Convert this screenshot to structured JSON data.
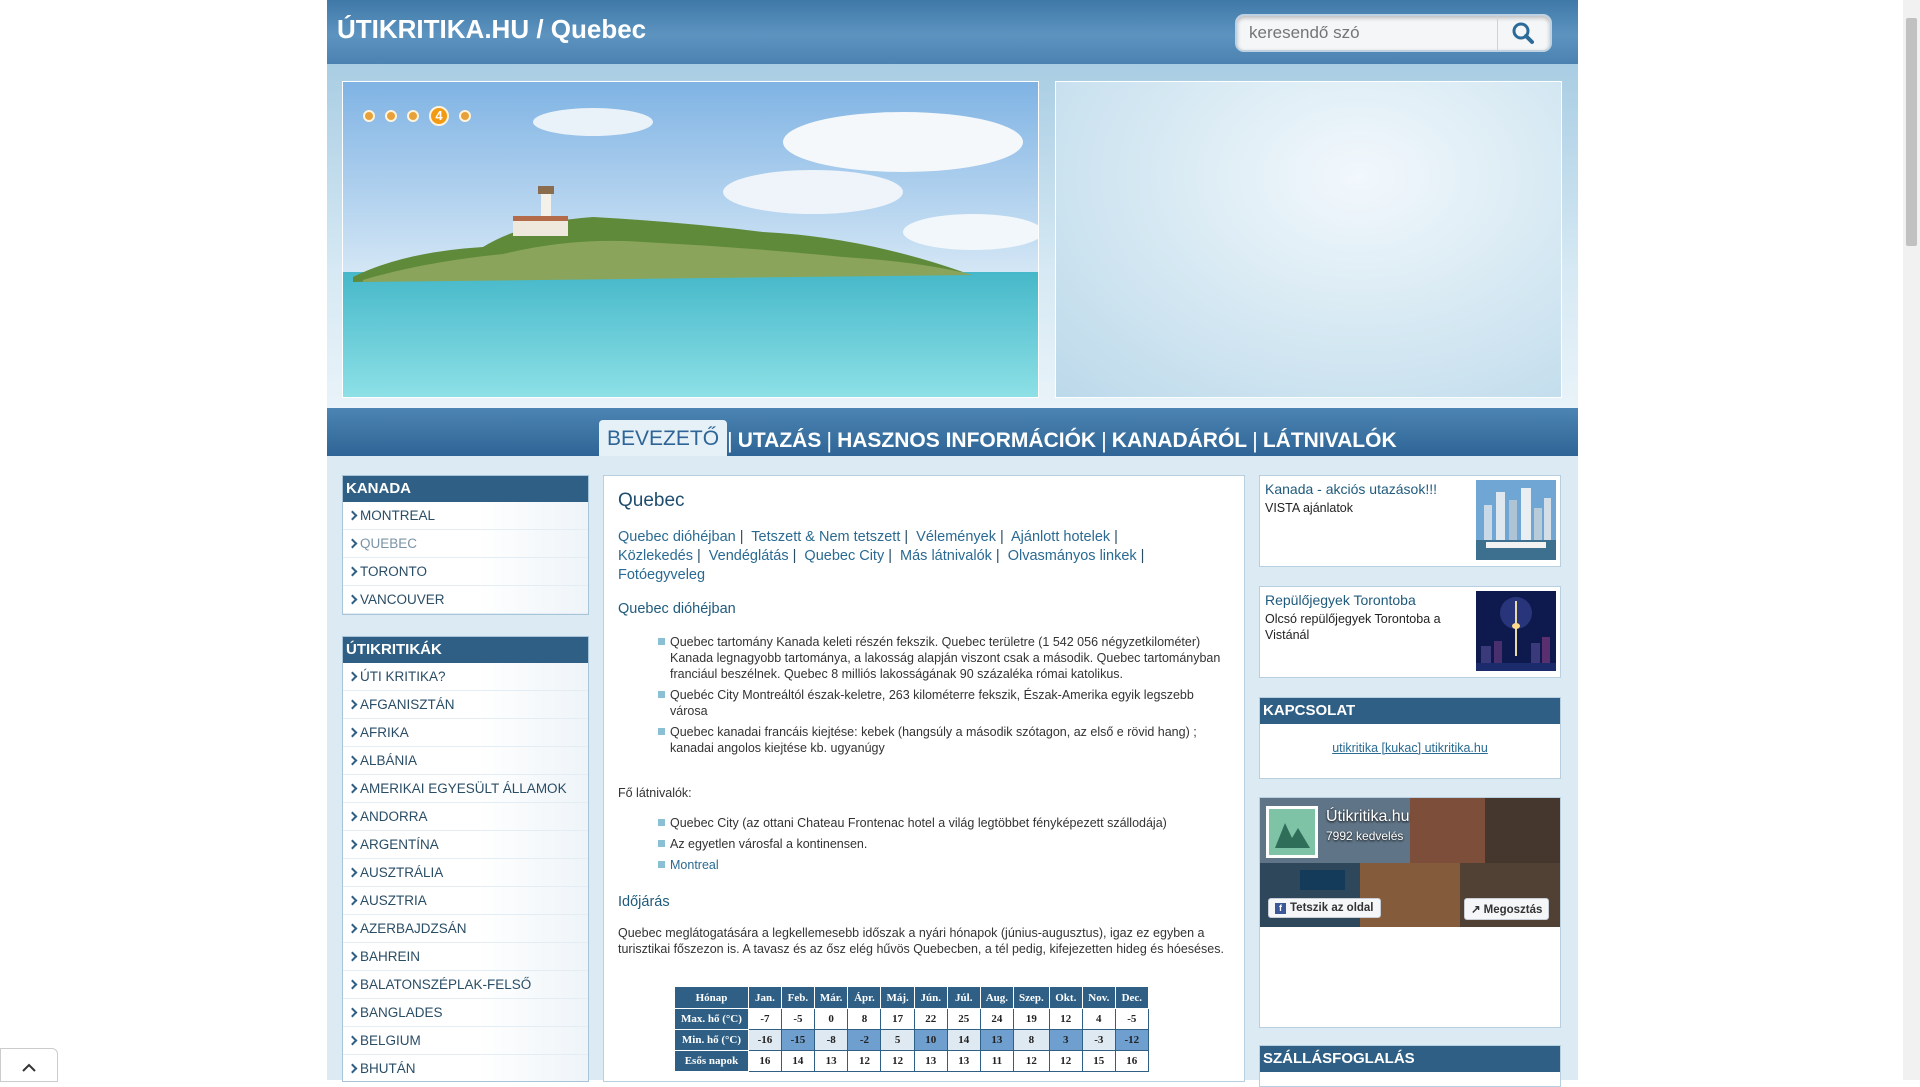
{
  "header": {
    "title": "ÚTIKRITIKA.HU / Quebec",
    "search_placeholder": "keresendő szó",
    "search_icon": "search-icon"
  },
  "slider": {
    "active_index": 4,
    "dot_count": 5,
    "active_label": "4"
  },
  "nav": {
    "items": [
      "BEVEZETŐ",
      "UTAZÁS",
      "HASZNOS INFORMÁCIÓK",
      "KANADÁRÓL",
      "LÁTNIVALÓK"
    ],
    "separator": "|"
  },
  "left": {
    "kanada": {
      "header": "KANADA",
      "items": [
        "MONTREAL",
        "QUEBEC",
        "TORONTO",
        "VANCOUVER"
      ],
      "current": "QUEBEC"
    },
    "utikritikak": {
      "header": "ÚTIKRITIKÁK",
      "items": [
        "ÚTI KRITIKA?",
        "AFGANISZTÁN",
        "AFRIKA",
        "ALBÁNIA",
        "AMERIKAI EGYESÜLT ÁLLAMOK",
        "ANDORRA",
        "ARGENTÍNA",
        "AUSZTRÁLIA",
        "AUSZTRIA",
        "AZERBAJDZSÁN",
        "BAHREIN",
        "BALATONSZÉPLAK-FELSŐ",
        "BANGLADES",
        "BELGIUM",
        "BHUTÁN"
      ]
    }
  },
  "main": {
    "title": "Quebec",
    "links": [
      "Quebec dióhéjban",
      "Tetszett & Nem tetszett",
      "Vélemények",
      "Ajánlott hotelek",
      "Közlekedés",
      "Vendéglátás",
      "Quebec City",
      "Más látnivalók",
      "Olvasmányos linkek",
      "Fotóegyveleg"
    ],
    "section1_title": "Quebec dióhéjban",
    "section1_items": [
      "Quebec tartomány Kanada keleti részén fekszik. Quebec területre (1 542 056 négyzetkilométer) Kanada legnagyobb tartománya, a lakosság alapján viszont csak a második. Quebec tartományban franciául beszélnek. Quebec 8 milliós lakosságának 90 százaléka római katolikus.",
      "Quebéc City Montreáltól észak-keletre, 263 kilométerre fekszik, Észak-Amerika egyik legszebb városa",
      "Quebec kanadai francáis kiejtése: kebek (hangsúly a második szótagon, az első e rövid hang) ; kanadai angolos kiejtése kb. ugyanúgy"
    ],
    "fo_latnivalok_label": "Fő látnivalók:",
    "fo_latnivalok": [
      "Quebec City (az ottani Chateau Frontenac hotel a világ legtöbbet fényképezett szállodája)",
      "Az egyetlen városfal a kontinensen.",
      "Montreal"
    ],
    "weather_title": "Időjárás",
    "weather_text": "Quebec meglátogatására a legkellemesebb időszak a nyári hónapok (június-augusztus), igaz ez egyben a turisztikai főszezon is. A tavasz és az ősz elég hűvös Quebecben, a tél pedig, kifejezetten hideg és hóeséses.",
    "weather_table": {
      "header_label": "Hónap",
      "months": [
        "Jan.",
        "Feb.",
        "Már.",
        "Ápr.",
        "Máj.",
        "Jún.",
        "Júl.",
        "Aug.",
        "Szep.",
        "Okt.",
        "Nov.",
        "Dec."
      ],
      "rows": [
        {
          "label": "Max. hő (°C)",
          "values": [
            "-7",
            "-5",
            "0",
            "8",
            "17",
            "22",
            "25",
            "24",
            "19",
            "12",
            "4",
            "-5"
          ]
        },
        {
          "label": "Min. hő (°C)",
          "values": [
            "-16",
            "-15",
            "-8",
            "-2",
            "5",
            "10",
            "14",
            "13",
            "8",
            "3",
            "-3",
            "-12"
          ]
        },
        {
          "label": "Esős napok",
          "values": [
            "16",
            "14",
            "13",
            "12",
            "12",
            "13",
            "13",
            "11",
            "12",
            "12",
            "15",
            "16"
          ]
        }
      ]
    }
  },
  "right": {
    "ad1": {
      "title": "Kanada - akciós utazások!!!",
      "desc": "VISTA ajánlatok"
    },
    "ad2": {
      "title": "Repülőjegyek Torontoba",
      "desc": "Olcsó repülőjegyek Torontoba a Vistánál"
    },
    "kapcsolat": {
      "header": "KAPCSOLAT",
      "email": "utikritika [kukac] utikritika.hu"
    },
    "facebook": {
      "page_name": "Útikritika.hu",
      "likes": "7992 kedvelés",
      "like_button": "Tetszik az oldal",
      "share_button": "Megosztás"
    },
    "szallas": {
      "header": "SZÁLLÁSFOGLALÁS"
    }
  }
}
